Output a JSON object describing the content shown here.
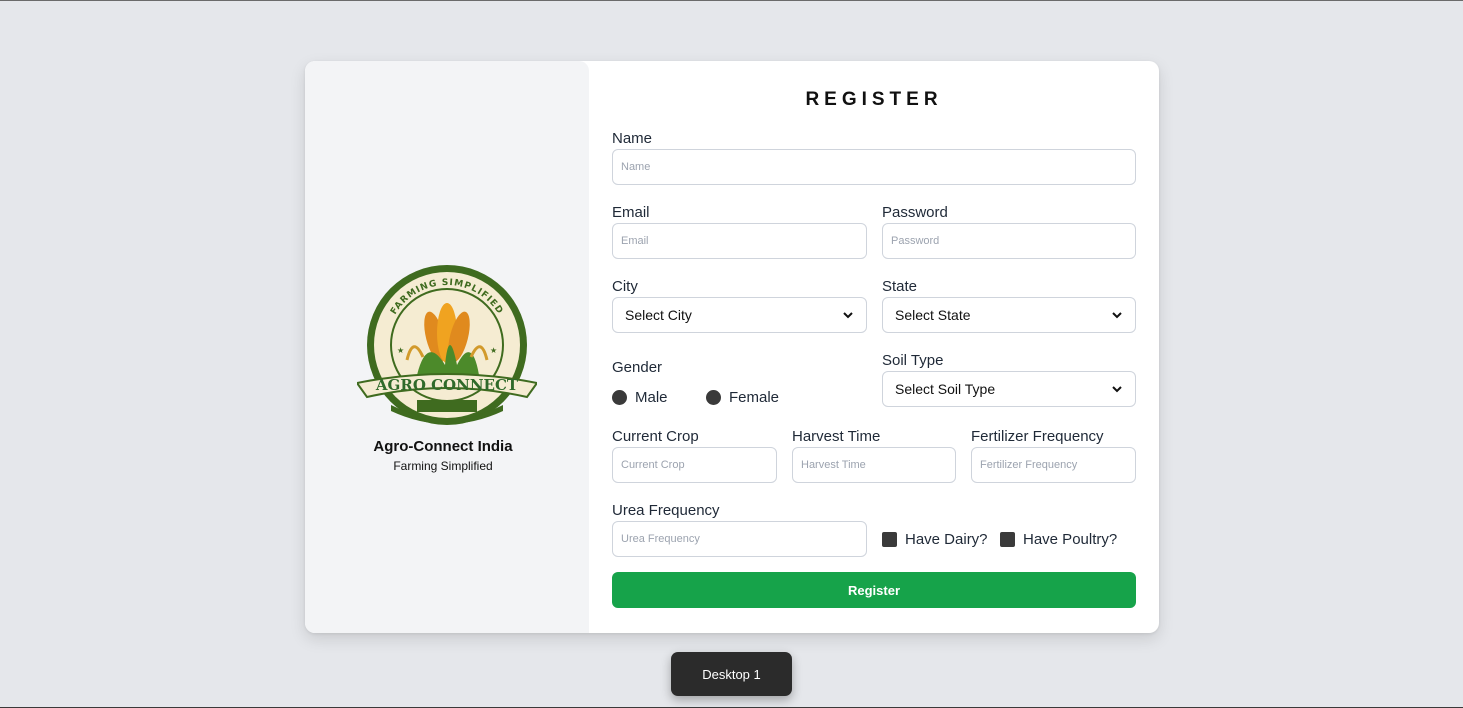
{
  "brand": {
    "name": "Agro-Connect India",
    "tagline": "Farming Simplified",
    "logo_arc_text": "FARMING SIMPLIFIED",
    "logo_banner_text": "AGRO CONNECT"
  },
  "form": {
    "title": "REGISTER",
    "name": {
      "label": "Name",
      "placeholder": "Name"
    },
    "email": {
      "label": "Email",
      "placeholder": "Email"
    },
    "password": {
      "label": "Password",
      "placeholder": "Password"
    },
    "city": {
      "label": "City",
      "selected": "Select City"
    },
    "state": {
      "label": "State",
      "selected": "Select State"
    },
    "gender": {
      "label": "Gender",
      "options": [
        "Male",
        "Female"
      ]
    },
    "soil_type": {
      "label": "Soil Type",
      "selected": "Select Soil Type"
    },
    "current_crop": {
      "label": "Current Crop",
      "placeholder": "Current Crop"
    },
    "harvest_time": {
      "label": "Harvest Time",
      "placeholder": "Harvest Time"
    },
    "fertilizer_frequency": {
      "label": "Fertilizer Frequency",
      "placeholder": "Fertilizer Frequency"
    },
    "urea_frequency": {
      "label": "Urea Frequency",
      "placeholder": "Urea Frequency"
    },
    "have_dairy": {
      "label": "Have Dairy?"
    },
    "have_poultry": {
      "label": "Have Poultry?"
    },
    "submit_label": "Register"
  },
  "taskbar": {
    "desktop_label": "Desktop 1"
  },
  "colors": {
    "accent": "#16a34a",
    "background": "#e5e7eb",
    "panel": "#f3f4f6"
  }
}
